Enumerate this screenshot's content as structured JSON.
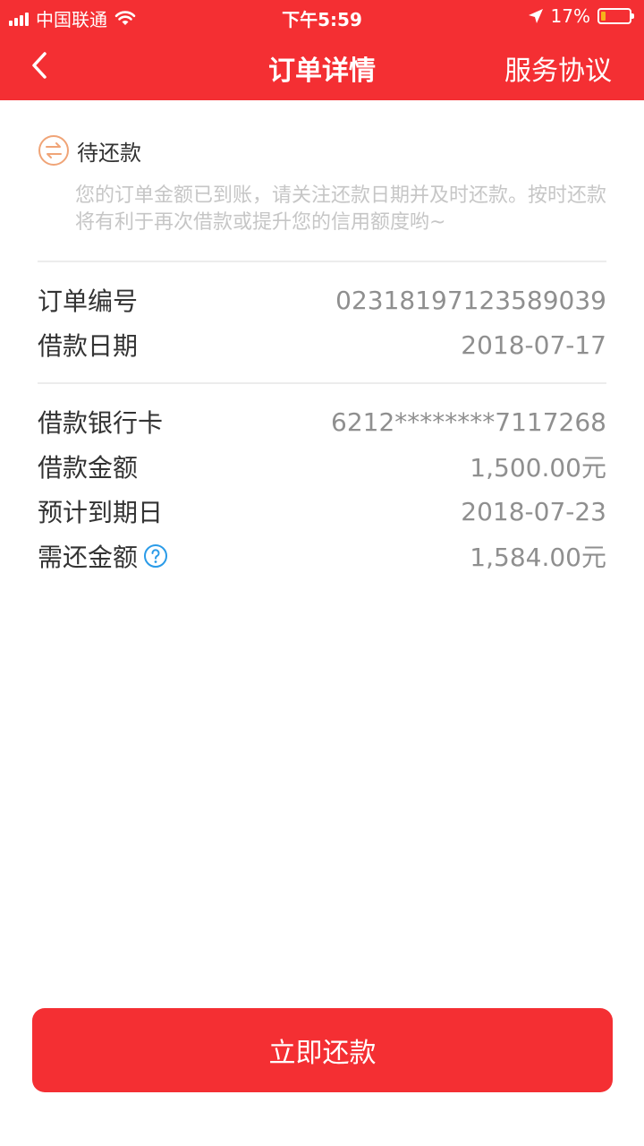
{
  "status_bar": {
    "carrier": "中国联通",
    "time": "下午5:59",
    "battery": "17%",
    "battery_level": 0.17
  },
  "nav": {
    "title": "订单详情",
    "right_link": "服务协议"
  },
  "order_status": {
    "label": "待还款",
    "notice": "您的订单金额已到账，请关注还款日期并及时还款。按时还款将有利于再次借款或提升您的信用额度哟~"
  },
  "order_info": [
    {
      "label": "订单编号",
      "value": "0231819712358903​9"
    },
    {
      "label": "借款日期",
      "value": "2018-07-17"
    }
  ],
  "loan_info": [
    {
      "label": "借款银行卡",
      "value": "6212********7117268"
    },
    {
      "label": "借款金额",
      "value": "1,500.00元"
    },
    {
      "label": "预计到期日",
      "value": "2018-07-23"
    },
    {
      "label": "需还金额",
      "value": "1,584.00元"
    }
  ],
  "cta": {
    "label": "立即还款"
  },
  "colors": {
    "brand": "#f42f33",
    "status_icon": "#f0a477",
    "help_icon": "#2a9be8"
  }
}
